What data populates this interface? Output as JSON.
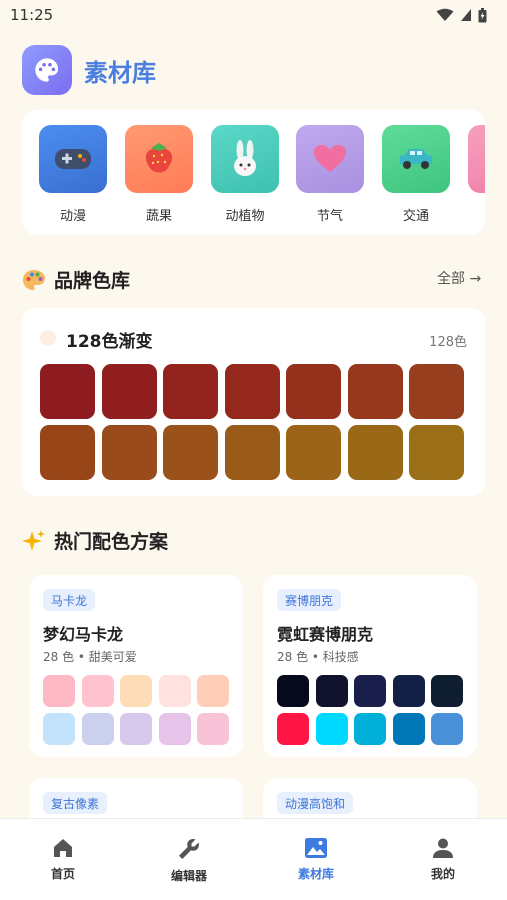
{
  "status": {
    "time": "11:25"
  },
  "app": {
    "title": "素材库",
    "logo_icon": "palette-icon"
  },
  "categories": [
    {
      "label": "动漫",
      "icon": "gamepad-icon",
      "color": "#4a86e8"
    },
    {
      "label": "蔬果",
      "icon": "strawberry-icon",
      "color": "#ff8a65"
    },
    {
      "label": "动植物",
      "icon": "rabbit-icon",
      "color": "#4dd0c0"
    },
    {
      "label": "节气",
      "icon": "heart-icon",
      "color": "#b39ddb"
    },
    {
      "label": "交通",
      "icon": "car-icon",
      "color": "#4ccf8a"
    },
    {
      "label": "",
      "icon": "",
      "color": "#f48fb1"
    }
  ],
  "brand_section": {
    "title": "品牌色库",
    "see_all": "全部 →",
    "card": {
      "name": "128色渐变",
      "count": "128色",
      "swatches": [
        "#8e1b1f",
        "#921f1f",
        "#93231d",
        "#94281d",
        "#95301d",
        "#97381c",
        "#963e1d",
        "#984518",
        "#994b1b",
        "#9a521a",
        "#9a5b1a",
        "#9c6419",
        "#996917",
        "#9a6f17"
      ]
    }
  },
  "popular_section": {
    "title": "热门配色方案",
    "palettes": [
      {
        "tag": "马卡龙",
        "name": "梦幻马卡龙",
        "meta": "28 色 • 甜美可爱",
        "swatches": [
          "#ffb9c6",
          "#ffc2cf",
          "#ffdcb8",
          "#ffe2e0",
          "#ffcdb8",
          "#c2e3fb",
          "#cbd0ee",
          "#d6c8ec",
          "#e6c4ea",
          "#f8c2d7"
        ]
      },
      {
        "tag": "赛博朋克",
        "name": "霓虹赛博朋克",
        "meta": "28 色 • 科技感",
        "swatches": [
          "#070a1a",
          "#11122c",
          "#1a1e4a",
          "#142146",
          "#0f1d30",
          "#ff1644",
          "#00d8ff",
          "#00b0d8",
          "#0078b8",
          "#4a90d9"
        ]
      },
      {
        "tag": "复古像素"
      },
      {
        "tag": "动漫高饱和"
      }
    ]
  },
  "bottom_nav": [
    {
      "label": "首页",
      "icon": "home-icon",
      "active": false
    },
    {
      "label": "编辑器",
      "icon": "wrench-icon",
      "active": false
    },
    {
      "label": "素材库",
      "icon": "image-icon",
      "active": true
    },
    {
      "label": "我的",
      "icon": "person-icon",
      "active": false
    }
  ],
  "colors": {
    "accent": "#3d7be0",
    "background": "#fdf8ee"
  }
}
